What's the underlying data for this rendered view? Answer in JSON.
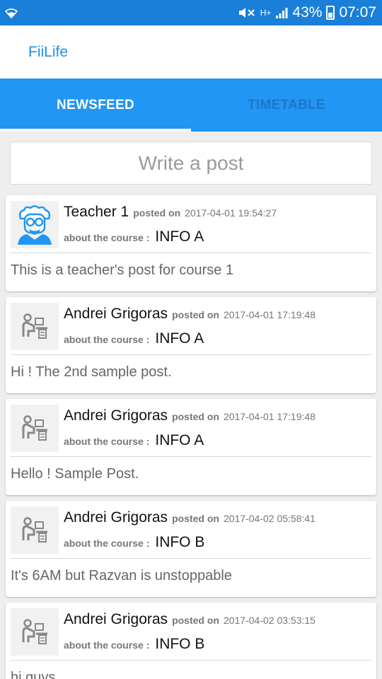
{
  "status_bar": {
    "network_type": "H+",
    "battery": "43%",
    "time": "07:07",
    "icons": [
      "wifi-icon",
      "mute-icon",
      "signal-icon",
      "battery-icon"
    ]
  },
  "app": {
    "title": "FiiLife"
  },
  "tabs": [
    {
      "label": "NEWSFEED",
      "active": true
    },
    {
      "label": "TIMETABLE",
      "active": false
    }
  ],
  "composer": {
    "placeholder": "Write a post"
  },
  "labels": {
    "posted_on": "posted on",
    "about_course": "about the course :"
  },
  "posts": [
    {
      "author": "Teacher 1",
      "date": "2017-04-01 19:54:27",
      "course": "INFO A",
      "text": "This is a teacher's post for course 1",
      "avatar": "teacher-icon"
    },
    {
      "author": "Andrei Grigoras",
      "date": "2017-04-01 17:19:48",
      "course": "INFO A",
      "text": "Hi ! The 2nd sample post.",
      "avatar": "student-desk-icon"
    },
    {
      "author": "Andrei Grigoras",
      "date": "2017-04-01 17:19:48",
      "course": "INFO A",
      "text": "Hello ! Sample Post.",
      "avatar": "student-desk-icon"
    },
    {
      "author": "Andrei Grigoras",
      "date": "2017-04-02 05:58:41",
      "course": "INFO B",
      "text": "It's 6AM but Razvan is unstoppable",
      "avatar": "student-desk-icon"
    },
    {
      "author": "Andrei Grigoras",
      "date": "2017-04-02 03:53:15",
      "course": "INFO B",
      "text": "hi guys",
      "avatar": "student-desk-icon"
    }
  ],
  "colors": {
    "status_bar": "#1a7fd8",
    "primary": "#2196f3",
    "title_text": "#1e8ee9",
    "inactive_tab": "#1a77c9",
    "background": "#eeeeee"
  }
}
